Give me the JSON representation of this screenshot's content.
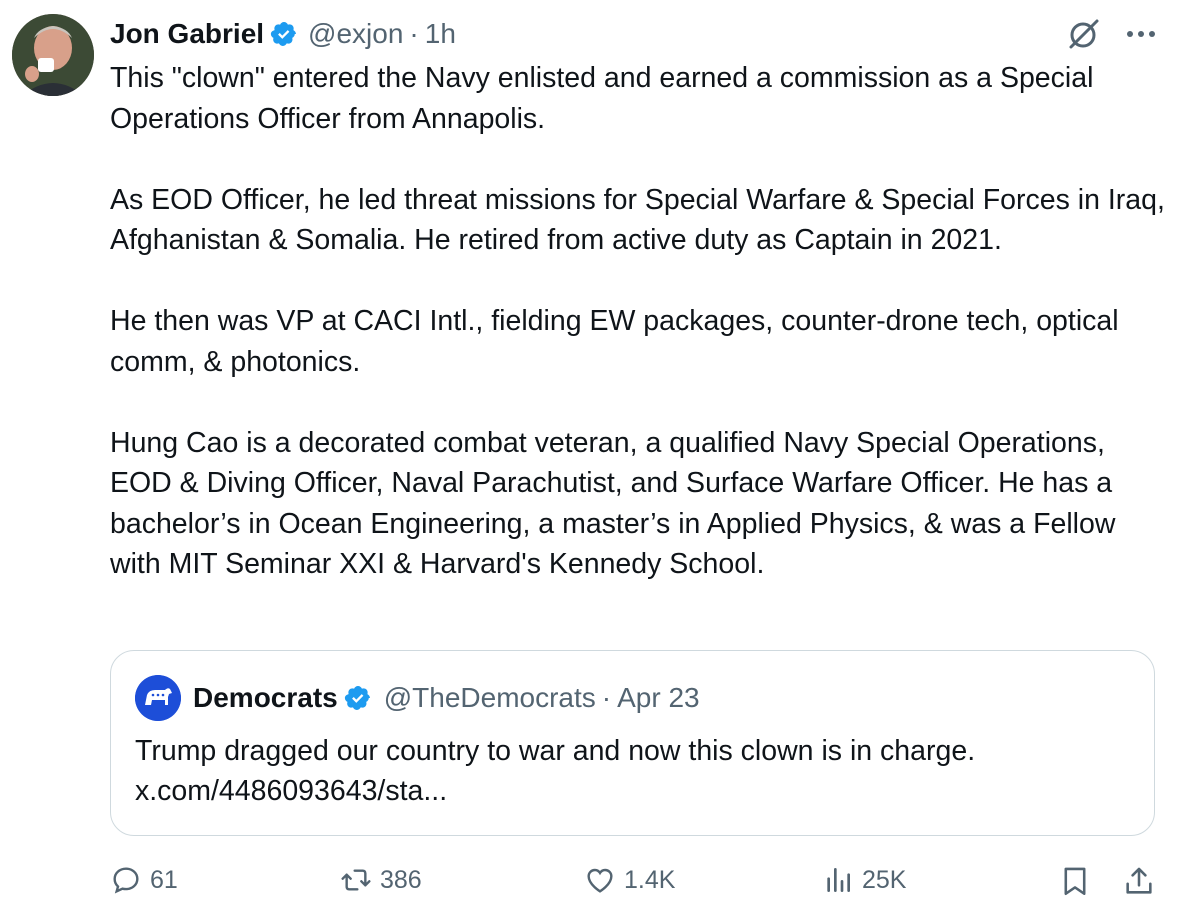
{
  "tweet": {
    "author": {
      "display_name": "Jon Gabriel",
      "handle": "@exjon",
      "verified": true
    },
    "separator": "·",
    "time": "1h",
    "paragraphs": [
      "This \"clown\" entered the Navy enlisted and earned a commission as a Special Operations Officer from Annapolis.",
      "As EOD Officer, he led threat missions for Special Warfare & Special Forces in Iraq, Afghanistan & Somalia. He retired from active duty as Captain in 2021.",
      "He then was VP at CACI Intl., fielding EW packages, counter-drone tech, optical comm, & photonics.",
      "Hung Cao is a decorated combat veteran, a qualified Navy Special Operations, EOD & Diving Officer, Naval Parachutist, and Surface Warfare Officer. He has a bachelor’s in Ocean Engineering, a master’s in Applied Physics, & was a Fellow with MIT Seminar XXI & Harvard's Kennedy School."
    ],
    "icons": {
      "grok": "grok-icon",
      "more": "more-icon"
    }
  },
  "quoted": {
    "display_name": "Democrats",
    "handle": "@TheDemocrats",
    "separator": "·",
    "date": "Apr 23",
    "text_line1": "Trump dragged our country to war and now this clown is in charge.",
    "text_line2": "x.com/4486093643/sta...",
    "verified": true
  },
  "actions": {
    "replies": "61",
    "reposts": "386",
    "likes": "1.4K",
    "views": "25K"
  },
  "colors": {
    "text": "#0f1419",
    "muted": "#536471",
    "verified": "#1d9bf0",
    "border": "#cfd9de"
  }
}
